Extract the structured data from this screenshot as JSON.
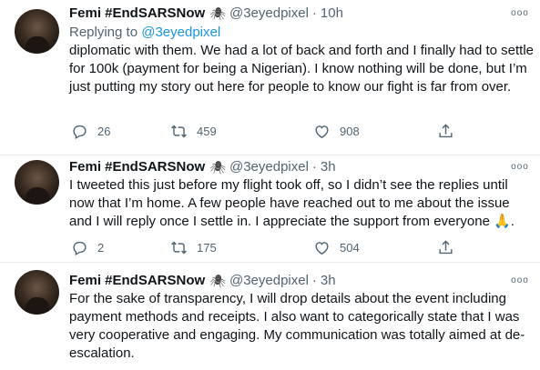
{
  "tweets": [
    {
      "name": "Femi #EndSARSNow",
      "emoji": "🕷",
      "handle": "@3eyedpixel",
      "separator": "·",
      "time": "10h",
      "replying_prefix": "Replying to",
      "replying_handle": "@3eyedpixel",
      "text": "diplomatic with them. We had a lot of back and forth and I finally had to settle for 100k (payment for being a Nigerian). I know nothing will be done, but I’m just putting my story out here for people to know our fight is far from over.",
      "replies": "26",
      "retweets": "459",
      "likes": "908"
    },
    {
      "name": "Femi #EndSARSNow",
      "emoji": "🕷",
      "handle": "@3eyedpixel",
      "separator": "·",
      "time": "3h",
      "text": "I tweeted this just before my flight took off, so I didn’t see the replies until now that I’m home. A few people have reached out to me about the issue and I will reply once I settle in. I appreciate the support from everyone 🙏.",
      "replies": "2",
      "retweets": "175",
      "likes": "504"
    },
    {
      "name": "Femi #EndSARSNow",
      "emoji": "🕷",
      "handle": "@3eyedpixel",
      "separator": "·",
      "time": "3h",
      "text": "For the sake of transparency, I will drop details about the event including payment methods and receipts. I also want to categorically state that I was very cooperative and engaging. My communication was totally aimed at de-escalation."
    }
  ],
  "more_glyph": "ooo",
  "colors": {
    "link": "#1b95e0",
    "secondary": "#536471",
    "divider": "#e6ecf0"
  },
  "icons": [
    "reply-icon",
    "retweet-icon",
    "like-icon",
    "share-icon",
    "more-icon",
    "spider-emoji"
  ]
}
